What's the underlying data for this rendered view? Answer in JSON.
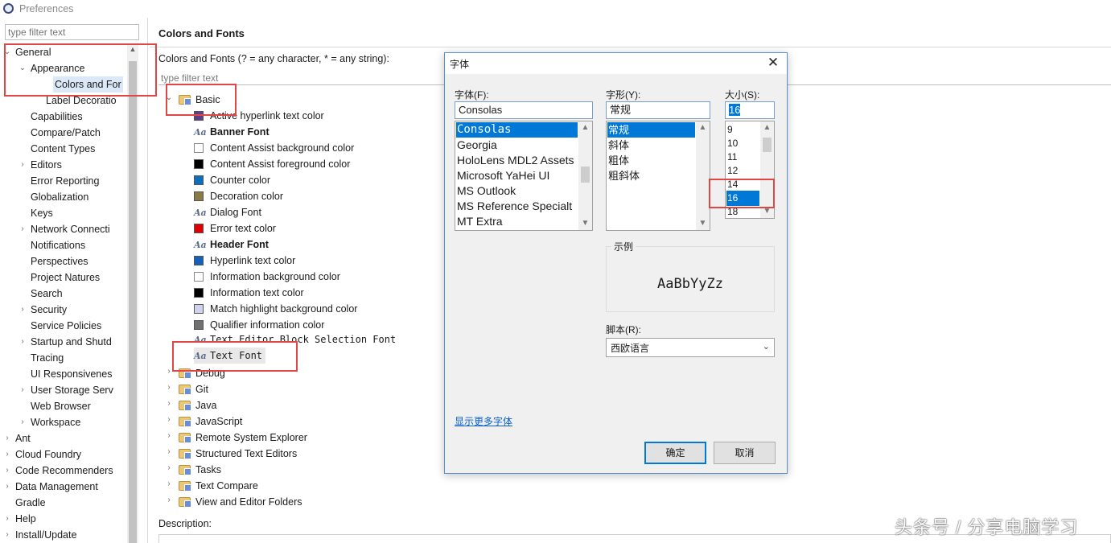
{
  "window": {
    "title": "Preferences"
  },
  "left": {
    "filter_placeholder": "type filter text",
    "tree": [
      {
        "label": "General",
        "twisty": "expanded",
        "indent": 0
      },
      {
        "label": "Appearance",
        "twisty": "expanded",
        "indent": 1
      },
      {
        "label": "Colors and For",
        "twisty": "none",
        "indent": 2,
        "selected": true
      },
      {
        "label": "Label Decoratio",
        "twisty": "none",
        "indent": 2
      },
      {
        "label": "Capabilities",
        "twisty": "none",
        "indent": 1
      },
      {
        "label": "Compare/Patch",
        "twisty": "none",
        "indent": 1
      },
      {
        "label": "Content Types",
        "twisty": "none",
        "indent": 1
      },
      {
        "label": "Editors",
        "twisty": "collapsed",
        "indent": 1
      },
      {
        "label": "Error Reporting",
        "twisty": "none",
        "indent": 1
      },
      {
        "label": "Globalization",
        "twisty": "none",
        "indent": 1
      },
      {
        "label": "Keys",
        "twisty": "none",
        "indent": 1
      },
      {
        "label": "Network Connecti",
        "twisty": "collapsed",
        "indent": 1
      },
      {
        "label": "Notifications",
        "twisty": "none",
        "indent": 1
      },
      {
        "label": "Perspectives",
        "twisty": "none",
        "indent": 1
      },
      {
        "label": "Project Natures",
        "twisty": "none",
        "indent": 1
      },
      {
        "label": "Search",
        "twisty": "none",
        "indent": 1
      },
      {
        "label": "Security",
        "twisty": "collapsed",
        "indent": 1
      },
      {
        "label": "Service Policies",
        "twisty": "none",
        "indent": 1
      },
      {
        "label": "Startup and Shutd",
        "twisty": "collapsed",
        "indent": 1
      },
      {
        "label": "Tracing",
        "twisty": "none",
        "indent": 1
      },
      {
        "label": "UI Responsivenes",
        "twisty": "none",
        "indent": 1
      },
      {
        "label": "User Storage Serv",
        "twisty": "collapsed",
        "indent": 1
      },
      {
        "label": "Web Browser",
        "twisty": "none",
        "indent": 1
      },
      {
        "label": "Workspace",
        "twisty": "collapsed",
        "indent": 1
      },
      {
        "label": "Ant",
        "twisty": "collapsed",
        "indent": 0
      },
      {
        "label": "Cloud Foundry",
        "twisty": "collapsed",
        "indent": 0
      },
      {
        "label": "Code Recommenders",
        "twisty": "collapsed",
        "indent": 0
      },
      {
        "label": "Data Management",
        "twisty": "collapsed",
        "indent": 0
      },
      {
        "label": "Gradle",
        "twisty": "none",
        "indent": 0
      },
      {
        "label": "Help",
        "twisty": "collapsed",
        "indent": 0
      },
      {
        "label": "Install/Update",
        "twisty": "collapsed",
        "indent": 0
      }
    ]
  },
  "main": {
    "title": "Colors and Fonts",
    "filter_label": "Colors and Fonts (? = any character, * = any string):",
    "filter_placeholder": "type filter text",
    "basic_label": "Basic",
    "basic_items": [
      {
        "label": "Active hyperlink text color",
        "kind": "color",
        "color": "#5b3f8a"
      },
      {
        "label": "Banner Font",
        "kind": "font",
        "bold": true
      },
      {
        "label": "Content Assist background color",
        "kind": "color",
        "color": "#ffffff"
      },
      {
        "label": "Content Assist foreground color",
        "kind": "color",
        "color": "#000000"
      },
      {
        "label": "Counter color",
        "kind": "color",
        "color": "#0a6fbf"
      },
      {
        "label": "Decoration color",
        "kind": "color",
        "color": "#8a7a46"
      },
      {
        "label": "Dialog Font",
        "kind": "font"
      },
      {
        "label": "Error text color",
        "kind": "color",
        "color": "#e00000"
      },
      {
        "label": "Header Font",
        "kind": "font",
        "bold": true
      },
      {
        "label": "Hyperlink text color",
        "kind": "color",
        "color": "#1560b8"
      },
      {
        "label": "Information background color",
        "kind": "color",
        "color": "#ffffff"
      },
      {
        "label": "Information text color",
        "kind": "color",
        "color": "#000000"
      },
      {
        "label": "Match highlight background color",
        "kind": "color",
        "color": "#d2d2ee"
      },
      {
        "label": "Qualifier information color",
        "kind": "color",
        "color": "#707070"
      },
      {
        "label": "Text Editor Block Selection Font",
        "kind": "font",
        "mono": true
      },
      {
        "label": "Text Font",
        "kind": "font",
        "mono": true,
        "selected": true
      }
    ],
    "folders": [
      "Debug",
      "Git",
      "Java",
      "JavaScript",
      "Remote System Explorer",
      "Structured Text Editors",
      "Tasks",
      "Text Compare",
      "View and Editor Folders"
    ],
    "description_label": "Description:"
  },
  "dialog": {
    "title": "字体",
    "font_label": "字体(F):",
    "font_value": "Consolas",
    "font_list": [
      "Consolas",
      "Georgia",
      "HoloLens MDL2 Assets",
      "Microsoft YaHei UI",
      "MS Outlook",
      "MS Reference Specialt",
      "MT Extra"
    ],
    "style_label": "字形(Y):",
    "style_value": "常规",
    "style_list": [
      "常规",
      "斜体",
      "粗体",
      "粗斜体"
    ],
    "size_label": "大小(S):",
    "size_value": "16",
    "size_list": [
      "9",
      "10",
      "11",
      "12",
      "14",
      "16",
      "18"
    ],
    "sample_label": "示例",
    "sample_text": "AaBbYyZz",
    "script_label": "脚本(R):",
    "script_value": "西欧语言",
    "more_fonts": "显示更多字体",
    "ok": "确定",
    "cancel": "取消"
  },
  "watermark": "头条号 / 分享电脑学习",
  "colors": {
    "selection": "#0078d7",
    "highlight_box": "#e04646",
    "link": "#0a62c9"
  }
}
